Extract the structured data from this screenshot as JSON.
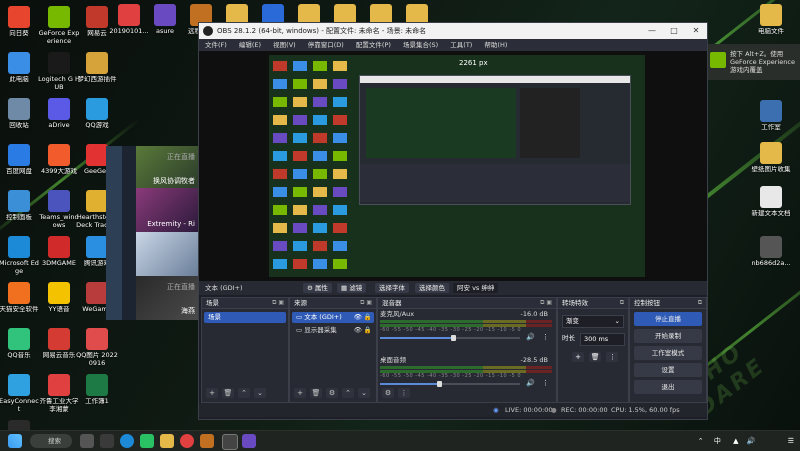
{
  "desktop": {
    "icons": [
      {
        "label": "向日葵",
        "color": "#e8452e"
      },
      {
        "label": "GeForce Experience",
        "color": "#76b900"
      },
      {
        "label": "网易云",
        "color": "#c0392b"
      },
      {
        "label": "此电脑",
        "color": "#3a8ee6"
      },
      {
        "label": "Logitech G HUB",
        "color": "#1a1a1a"
      },
      {
        "label": "梦幻西游插件",
        "color": "#d6a23a"
      },
      {
        "label": "回收站",
        "color": "#6f8aa6"
      },
      {
        "label": "aDrive",
        "color": "#5a5ae6"
      },
      {
        "label": "QQ游戏",
        "color": "#2b9be0"
      },
      {
        "label": "百度网盘",
        "color": "#2a7be4"
      },
      {
        "label": "4399大游戏",
        "color": "#f25c2c"
      },
      {
        "label": "GeeGee",
        "color": "#e23232"
      },
      {
        "label": "控制面板",
        "color": "#3b8fd6"
      },
      {
        "label": "Teams_windows",
        "color": "#4b53bc"
      },
      {
        "label": "Hearthstone Deck Tracker",
        "color": "#e0b030"
      },
      {
        "label": "Microsoft Edge",
        "color": "#1d8ad8"
      },
      {
        "label": "3DMGAME",
        "color": "#d12a2a"
      },
      {
        "label": "腾讯游戏",
        "color": "#2a8fe0"
      },
      {
        "label": "天猫安全软件",
        "color": "#f07020"
      },
      {
        "label": "YY语音",
        "color": "#f5c200"
      },
      {
        "label": "WeGame",
        "color": "#b93c3c"
      },
      {
        "label": "QQ音乐",
        "color": "#31c27c"
      },
      {
        "label": "网易云音乐",
        "color": "#d43c33"
      },
      {
        "label": "QQ图片 20220916",
        "color": "#e04c4c"
      },
      {
        "label": "EasyConnect",
        "color": "#2fa0e0"
      },
      {
        "label": "齐鲁工业大学 李湘蒙",
        "color": "#e04040"
      },
      {
        "label": "工作簿1",
        "color": "#1e7a45"
      },
      {
        "label": "Dark and Darker A5",
        "color": "#2a2a2a"
      }
    ],
    "top_icons": [
      "向日葵",
      "GeForce",
      "网易云",
      "20190101...",
      "asure",
      "远程控制",
      "文件夹",
      "PCL",
      "文件夹",
      "文件夹",
      "文件夹",
      "文件夹"
    ],
    "right_icons": [
      {
        "label": "电脑文件",
        "color": "#e5b84a"
      },
      {
        "label": "工作室",
        "color": "#3b6fb0"
      },
      {
        "label": "壁纸图片收集",
        "color": "#e5b84a"
      },
      {
        "label": "新建文本文档",
        "color": "#e8e8e8"
      },
      {
        "label": "nb686d2a...",
        "color": "#555"
      }
    ],
    "video_cards": [
      {
        "pre": "正在直播",
        "label": "换风协调牧者"
      },
      {
        "pre": "",
        "label": "Extremity - Ri"
      },
      {
        "pre": "",
        "label": ""
      },
      {
        "pre": "正在直播",
        "label": "海燕"
      }
    ]
  },
  "toast": {
    "text": "按下 Alt+Z。使用 GeForce Experience 游戏内覆盖"
  },
  "obs": {
    "title": "OBS 28.1.2 (64-bit, windows) - 配置文件: 未命名 - 场景: 未命名",
    "menu": [
      "文件(F)",
      "编辑(E)",
      "视图(V)",
      "停靠窗口(D)",
      "配置文件(P)",
      "场景集合(S)",
      "工具(T)",
      "帮助(H)"
    ],
    "preview_px": "2261 px",
    "context_source": "文本 (GDI+)",
    "context_buttons": [
      "属性",
      "滤镜",
      "选择字体",
      "选择颜色",
      "阿安 vs 绅绅"
    ],
    "scenes": {
      "title": "场景",
      "items": [
        "场景"
      ]
    },
    "sources": {
      "title": "来源",
      "items": [
        "文本 (GDI+)",
        "显示器采集"
      ]
    },
    "mixer": {
      "title": "混音器",
      "channels": [
        {
          "name": "麦克风/Aux",
          "db": "-16.0 dB",
          "level": 0.52
        },
        {
          "name": "桌面音频",
          "db": "-28.5 dB",
          "level": 0.42
        }
      ],
      "ticks": "-60 -55 -50 -45 -40 -35 -30 -25 -20 -15 -10 -5 0"
    },
    "transitions": {
      "title": "转场特效",
      "type": "渐变",
      "duration_label": "时长",
      "duration": "300 ms"
    },
    "controls": {
      "title": "控制按钮",
      "buttons": [
        "停止直播",
        "开始录制",
        "工作室模式",
        "设置",
        "退出"
      ]
    },
    "status": {
      "live": "LIVE: 00:00:00",
      "rec": "REC: 00:00:00",
      "cpu": "CPU: 1.5%, 60.00 fps"
    }
  },
  "taskbar": {
    "search": "搜索",
    "lang": "中"
  }
}
